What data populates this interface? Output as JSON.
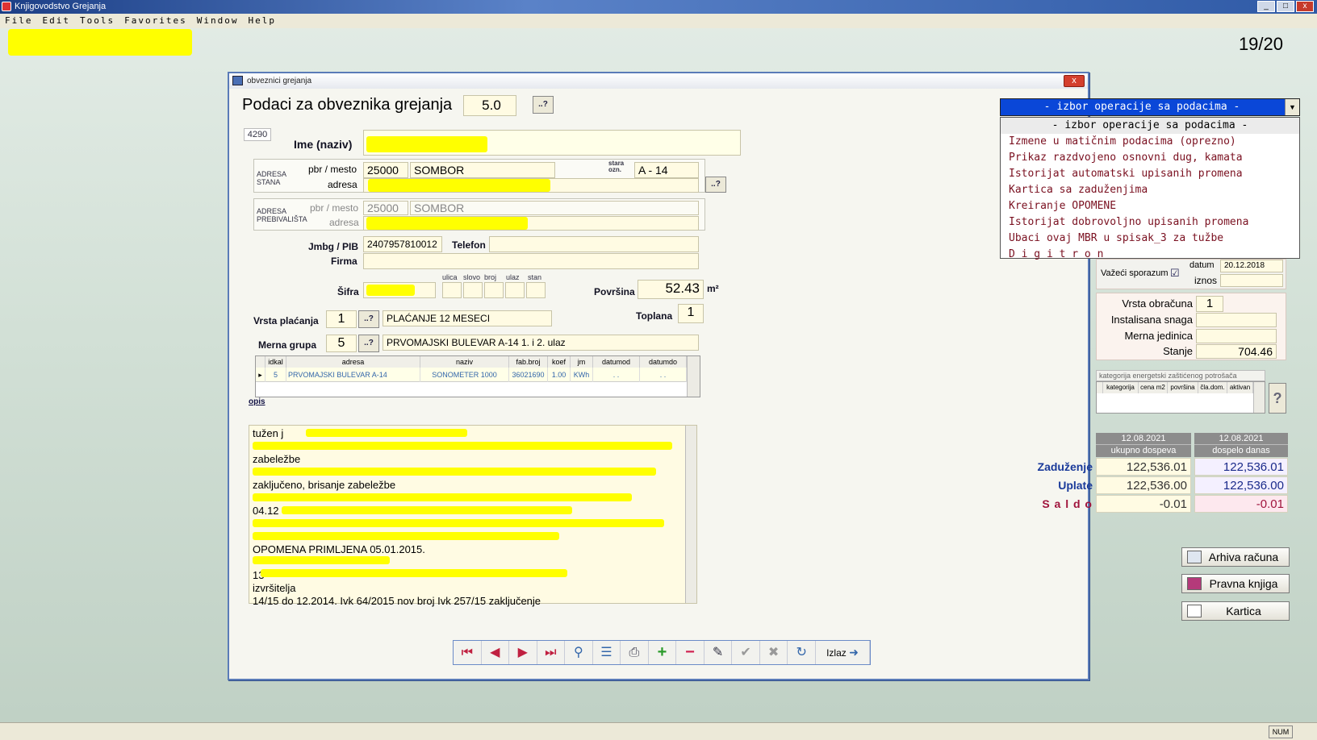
{
  "app": {
    "title": "Knjigovodstvo Grejanja",
    "page_counter": "19/20",
    "menu": [
      "File",
      "Edit",
      "Tools",
      "Favorites",
      "Window",
      "Help"
    ],
    "window_buttons": [
      "_",
      "□",
      "x"
    ]
  },
  "dialog": {
    "title": "obveznici grejanja",
    "heading": "Podaci za obveznika grejanja",
    "version": "5.0",
    "help_btn": "..?",
    "close_btn": "x",
    "record_id": "4290",
    "name_label": "Ime (naziv)",
    "stan": {
      "section": "ADRESA STANA",
      "pbr_label": "pbr / mesto",
      "pbr": "25000",
      "mesto": "SOMBOR",
      "adresa_label": "adresa",
      "stara_label": "stara ozn.",
      "stara": "A - 14"
    },
    "preb": {
      "section": "ADRESA PREBIVALIŠTA",
      "pbr_label": "pbr / mesto",
      "pbr": "25000",
      "mesto": "SOMBOR",
      "adresa_label": "adresa"
    },
    "jmbg_label": "Jmbg / PIB",
    "jmbg": "2407957810012",
    "telefon_label": "Telefon",
    "firma_label": "Firma",
    "sifra_label": "Šifra",
    "sifra_cols": [
      "ulica",
      "slovo",
      "broj",
      "ulaz",
      "stan"
    ],
    "povrsina_label": "Površina",
    "povrsina": "52.43",
    "povrsina_unit": "m²",
    "toplana_label": "Toplana",
    "toplana": "1",
    "vrsta_label": "Vrsta plaćanja",
    "vrsta": "1",
    "vrsta_text": "PLAĆANJE 12 MESECI",
    "merna_label": "Merna grupa",
    "merna": "5",
    "merna_text": "PRVOMAJSKI BULEVAR A-14 1. i 2. ulaz",
    "grid": {
      "headers": [
        "idkal",
        "adresa",
        "naziv",
        "fab.broj",
        "koef",
        "jm",
        "datumod",
        "datumdo"
      ],
      "row": [
        "5",
        "PRVOMAJSKI BULEVAR A-14",
        "SONOMETER 1000",
        "36021690",
        "1.00",
        "KWh",
        ". .",
        ". ."
      ]
    },
    "opis_label": "opis",
    "opis_text": "tužen j\n\nzabeležbe\n\nzaključeno, brisanje zabeležbe\n\n04.12\n\n\nOPOMENA PRIMLJENA 05.01.2015.\n\n13\nizvršitelja\n14/15 do 12.2014. Ivk 64/2015 nov broj Ivk 257/15 zaključenje",
    "dropdown": {
      "selected": "- izbor operacije sa podacima -",
      "options": [
        "- izbor operacije sa podacima -",
        "Izmene u matičnim podacima (oprezno)",
        "Prikaz razdvojeno osnovni dug, kamata",
        "Istorijat automatski upisanih promena",
        "Kartica sa zaduženjima",
        "Kreiranje OPOMENE",
        "Istorijat dobrovoljno upisanih promena",
        "Ubaci ovaj MBR u spisak_3 za tužbe",
        "D i g i t r o n"
      ]
    },
    "sporazum": {
      "label": "Važeći sporazum",
      "checked": "☑",
      "datum_label": "datum",
      "datum": "20.12.2018",
      "iznos_label": "iznos"
    },
    "obracun": {
      "vrsta_label": "Vrsta obračuna",
      "vrsta": "1",
      "snaga_label": "Instalisana snaga",
      "jedinica_label": "Merna jedinica",
      "stanje_label": "Stanje",
      "stanje": "704.46"
    },
    "kategorija": {
      "title": "kategorija energetski zaštićenog potrošača",
      "headers": [
        "kategorija",
        "cena m2",
        "površina",
        "čla.dom.",
        "aktivan"
      ],
      "help": "?"
    },
    "finance": {
      "col1_date": "12.08.2021",
      "col1_sub": "ukupno dospeva",
      "col2_date": "12.08.2021",
      "col2_sub": "dospelo danas",
      "rows": [
        {
          "label": "Zaduženje",
          "v1": "122,536.01",
          "v2": "122,536.01"
        },
        {
          "label": "Uplate",
          "v1": "122,536.00",
          "v2": "122,536.00"
        },
        {
          "label": "S a l d o",
          "v1": "-0.01",
          "v2": "-0.01"
        }
      ]
    },
    "buttons": {
      "arhiva": "Arhiva računa",
      "pravna": "Pravna knjiga",
      "kartica": "Kartica"
    },
    "toolbar": {
      "first": "⏮",
      "prev": "◀",
      "next": "▶",
      "last": "⏭",
      "izlaz": "Izlaz"
    }
  },
  "status": {
    "num": "NUM"
  },
  "colors": {
    "accent": "#0a47d8",
    "highlight": "#ffff00",
    "option_text": "#7a1020"
  }
}
